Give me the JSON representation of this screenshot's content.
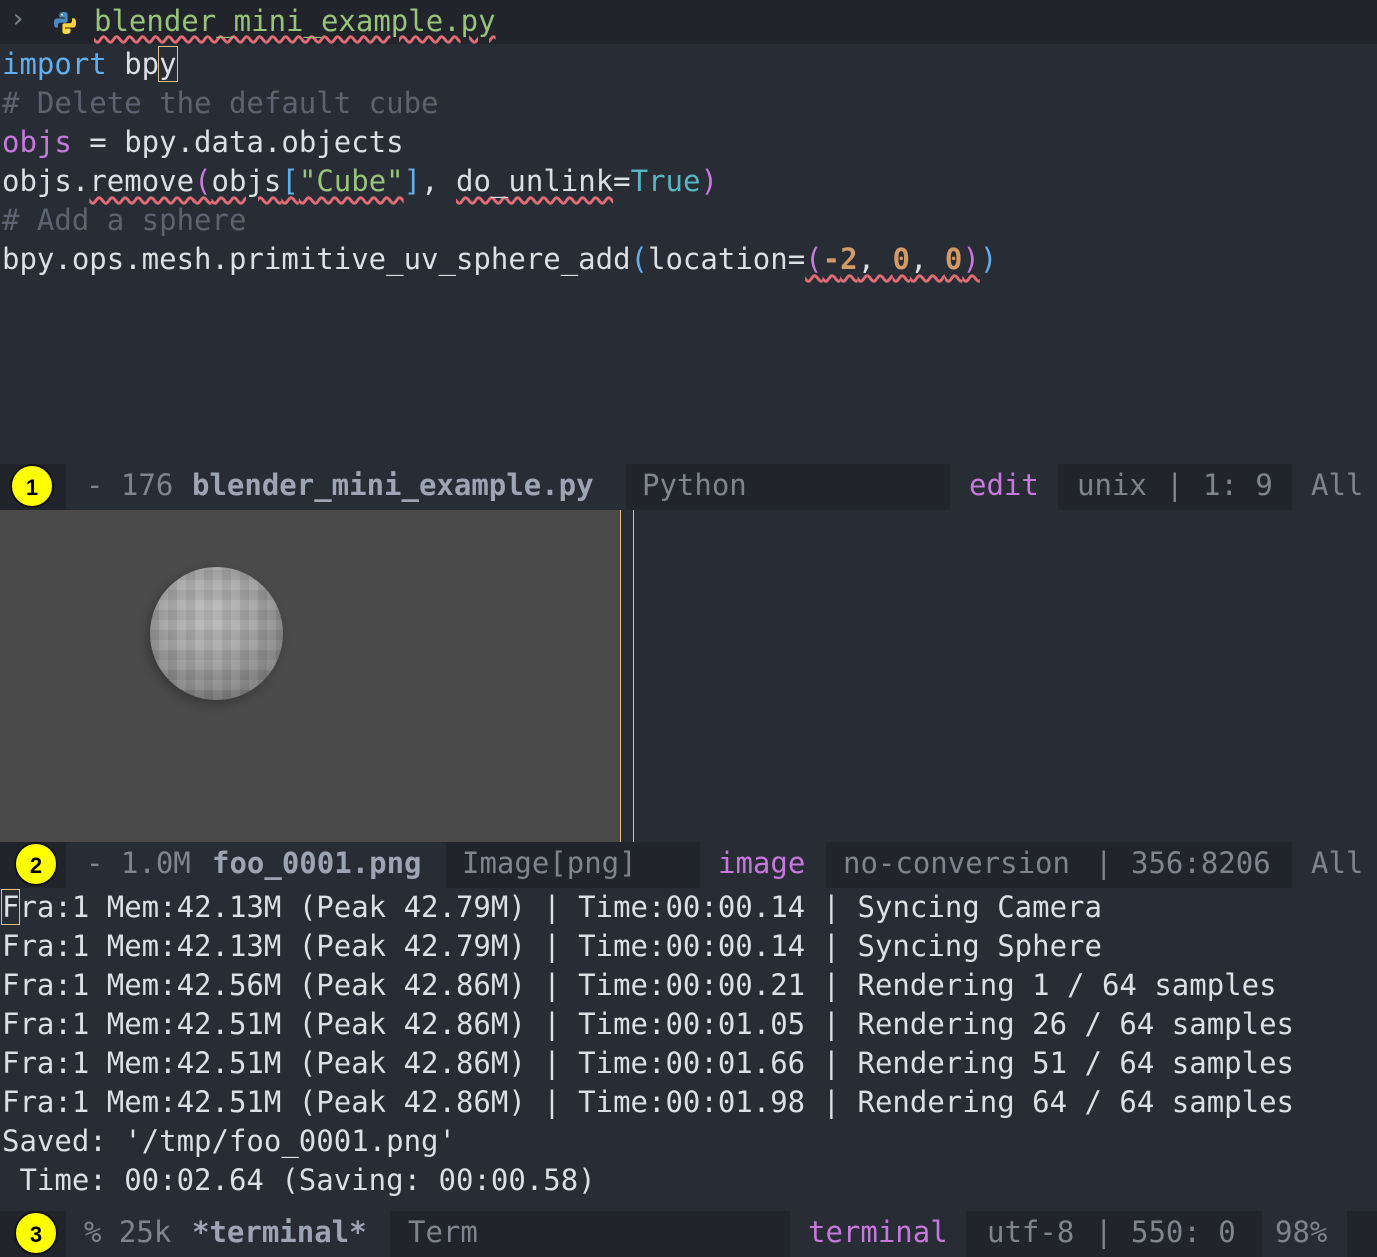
{
  "header": {
    "chevron": "›",
    "filename": "blender_mini_example.py"
  },
  "code_lines": [
    "import bpy",
    "# Delete the default cube",
    "objs = bpy.data.objects",
    "objs.remove(objs[\"Cube\"], do_unlink=True)",
    "# Add a sphere",
    "bpy.ops.mesh.primitive_uv_sphere_add(location=(-2, 0, 0))"
  ],
  "code": {
    "l1_kw": "import",
    "l1_rest": " bp",
    "l1_cursor": "y",
    "l2": "# Delete the default cube",
    "l3_var": "objs",
    "l3_rest": " = bpy.data.objects",
    "l4_a": "objs.",
    "l4_fn": "remove",
    "l4_p1": "(",
    "l4_b": "objs",
    "l4_br1": "[",
    "l4_str": "\"Cube\"",
    "l4_br2": "]",
    "l4_c": ", ",
    "l4_kwarg": "do_unlink",
    "l4_eq": "=",
    "l4_true": "True",
    "l4_p2": ")",
    "l5": "# Add a sphere",
    "l6_a": "bpy.ops.mesh.primitive_uv_sphere_add",
    "l6_p1": "(",
    "l6_b": "location=",
    "l6_p2": "(",
    "l6_minus": "-",
    "l6_n1": "2",
    "l6_sep1": ", ",
    "l6_n2": "0",
    "l6_sep2": ", ",
    "l6_n3": "0",
    "l6_p3": ")",
    "l6_p4": ")"
  },
  "modeline1": {
    "badge": "1",
    "prefix": "- 176 ",
    "buffer": "blender_mini_example.py",
    "major_mode": "Python",
    "state": "edit",
    "encoding": "unix",
    "sep": "|",
    "position": "1: 9",
    "scroll": "All"
  },
  "modeline2": {
    "badge": "2",
    "prefix": "- 1.0M ",
    "buffer": "foo_0001.png",
    "major_mode": "Image[png]",
    "state": "image",
    "encoding": "no-conversion",
    "sep": "|",
    "position": "356:8206",
    "scroll": "All"
  },
  "terminal_lines": [
    "ra:1 Mem:42.13M (Peak 42.79M) | Time:00:00.14 | Syncing Camera",
    "Fra:1 Mem:42.13M (Peak 42.79M) | Time:00:00.14 | Syncing Sphere",
    "Fra:1 Mem:42.56M (Peak 42.86M) | Time:00:00.21 | Rendering 1 / 64 samples",
    "Fra:1 Mem:42.51M (Peak 42.86M) | Time:00:01.05 | Rendering 26 / 64 samples",
    "Fra:1 Mem:42.51M (Peak 42.86M) | Time:00:01.66 | Rendering 51 / 64 samples",
    "Fra:1 Mem:42.51M (Peak 42.86M) | Time:00:01.98 | Rendering 64 / 64 samples",
    "Saved: '/tmp/foo_0001.png'",
    " Time: 00:02.64 (Saving: 00:00.58)"
  ],
  "terminal_first_char": "F",
  "modeline3": {
    "badge": "3",
    "prefix": "% 25k ",
    "buffer": "*terminal*",
    "major_mode": "Term",
    "state": "terminal",
    "encoding": "utf-8",
    "sep": "|",
    "position": "550: 0",
    "scroll": "98%"
  },
  "icons": {
    "python": "python-icon",
    "chevron": "chevron-right-icon"
  },
  "colors": {
    "background": "#282c34",
    "modeline_bg": "#21252b",
    "keyword": "#61afef",
    "string": "#98c379",
    "variable": "#c678dd",
    "number": "#d19a66",
    "cursor": "#e5c07b"
  }
}
